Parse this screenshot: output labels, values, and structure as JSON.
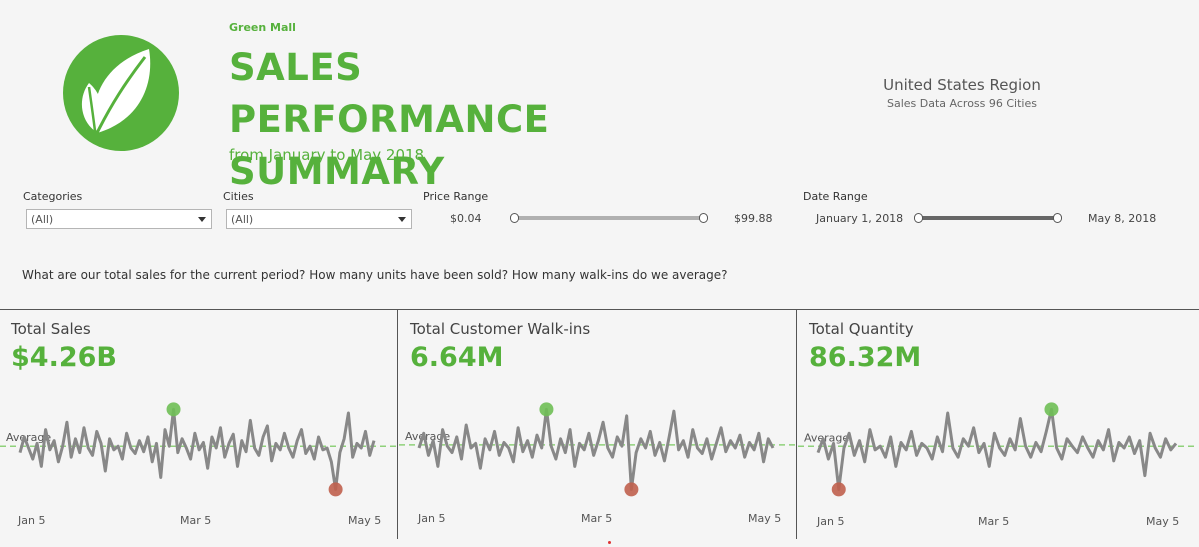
{
  "header": {
    "brand": "Green Mall",
    "title": "SALES PERFORMANCE SUMMARY",
    "subtitle": "from January to May 2018",
    "region": "United States Region",
    "region_sub": "Sales Data Across 96 Cities",
    "logo_icon": "leaf-icon"
  },
  "filters": {
    "categories": {
      "label": "Categories",
      "value": "(All)"
    },
    "cities": {
      "label": "Cities",
      "value": "(All)"
    },
    "price_range": {
      "label": "Price Range",
      "min": "$0.04",
      "max": "$99.88"
    },
    "date_range": {
      "label": "Date Range",
      "start": "January 1, 2018",
      "end": "May 8, 2018"
    }
  },
  "question": "What are our total sales for the current period? How many units have been sold? How many walk-ins do we average?",
  "colors": {
    "accent": "#56b13c",
    "line": "#888888",
    "max_dot": "#6fbf55",
    "min_dot": "#c0604e",
    "avg_line": "#8fd17a"
  },
  "panels": [
    {
      "title": "Total Sales",
      "value": "$4.26B",
      "avg_label": "Average",
      "x_ticks": [
        "Jan 5",
        "Mar 5",
        "May 5"
      ],
      "series": [
        0.45,
        0.62,
        0.5,
        0.38,
        0.55,
        0.3,
        0.7,
        0.48,
        0.58,
        0.35,
        0.52,
        0.78,
        0.4,
        0.6,
        0.45,
        0.72,
        0.5,
        0.42,
        0.68,
        0.55,
        0.25,
        0.6,
        0.48,
        0.52,
        0.38,
        0.66,
        0.5,
        0.44,
        0.58,
        0.46,
        0.62,
        0.35,
        0.55,
        0.18,
        0.7,
        0.52,
        0.92,
        0.45,
        0.6,
        0.5,
        0.38,
        0.66,
        0.48,
        0.56,
        0.28,
        0.62,
        0.5,
        0.72,
        0.4,
        0.55,
        0.65,
        0.3,
        0.58,
        0.46,
        0.8,
        0.5,
        0.42,
        0.62,
        0.74,
        0.36,
        0.55,
        0.48,
        0.66,
        0.5,
        0.4,
        0.58,
        0.7,
        0.44,
        0.52,
        0.38,
        0.62,
        0.48,
        0.5,
        0.35,
        0.05,
        0.45,
        0.6,
        0.88,
        0.4,
        0.55,
        0.5,
        0.68,
        0.42,
        0.58
      ]
    },
    {
      "title": "Total Customer Walk-ins",
      "value": "6.64M",
      "avg_label": "Average",
      "x_ticks": [
        "Jan 5",
        "Mar 5",
        "May 5"
      ],
      "series": [
        0.5,
        0.66,
        0.42,
        0.58,
        0.3,
        0.7,
        0.52,
        0.45,
        0.62,
        0.38,
        0.75,
        0.5,
        0.55,
        0.28,
        0.6,
        0.48,
        0.68,
        0.42,
        0.56,
        0.5,
        0.35,
        0.72,
        0.46,
        0.58,
        0.4,
        0.64,
        0.5,
        0.92,
        0.52,
        0.38,
        0.6,
        0.45,
        0.7,
        0.3,
        0.55,
        0.48,
        0.66,
        0.42,
        0.58,
        0.78,
        0.5,
        0.4,
        0.62,
        0.52,
        0.85,
        0.05,
        0.45,
        0.6,
        0.5,
        0.68,
        0.42,
        0.56,
        0.36,
        0.62,
        0.9,
        0.48,
        0.58,
        0.4,
        0.7,
        0.5,
        0.44,
        0.6,
        0.38,
        0.55,
        0.72,
        0.46,
        0.58,
        0.5,
        0.64,
        0.4,
        0.56,
        0.48,
        0.66,
        0.35,
        0.6,
        0.5
      ]
    },
    {
      "title": "Total Quantity",
      "value": "86.32M",
      "avg_label": "Average",
      "x_ticks": [
        "Jan 5",
        "Mar 5",
        "May 5"
      ],
      "series": [
        0.45,
        0.6,
        0.38,
        0.55,
        0.05,
        0.5,
        0.66,
        0.42,
        0.58,
        0.35,
        0.7,
        0.48,
        0.52,
        0.4,
        0.62,
        0.3,
        0.56,
        0.48,
        0.68,
        0.42,
        0.55,
        0.5,
        0.38,
        0.62,
        0.46,
        0.88,
        0.5,
        0.4,
        0.6,
        0.52,
        0.72,
        0.45,
        0.55,
        0.3,
        0.66,
        0.5,
        0.42,
        0.6,
        0.48,
        0.82,
        0.52,
        0.4,
        0.56,
        0.46,
        0.68,
        0.92,
        0.5,
        0.38,
        0.6,
        0.52,
        0.45,
        0.62,
        0.5,
        0.4,
        0.58,
        0.48,
        0.7,
        0.36,
        0.56,
        0.5,
        0.62,
        0.44,
        0.58,
        0.2,
        0.66,
        0.5,
        0.4,
        0.6,
        0.48,
        0.55
      ]
    }
  ]
}
